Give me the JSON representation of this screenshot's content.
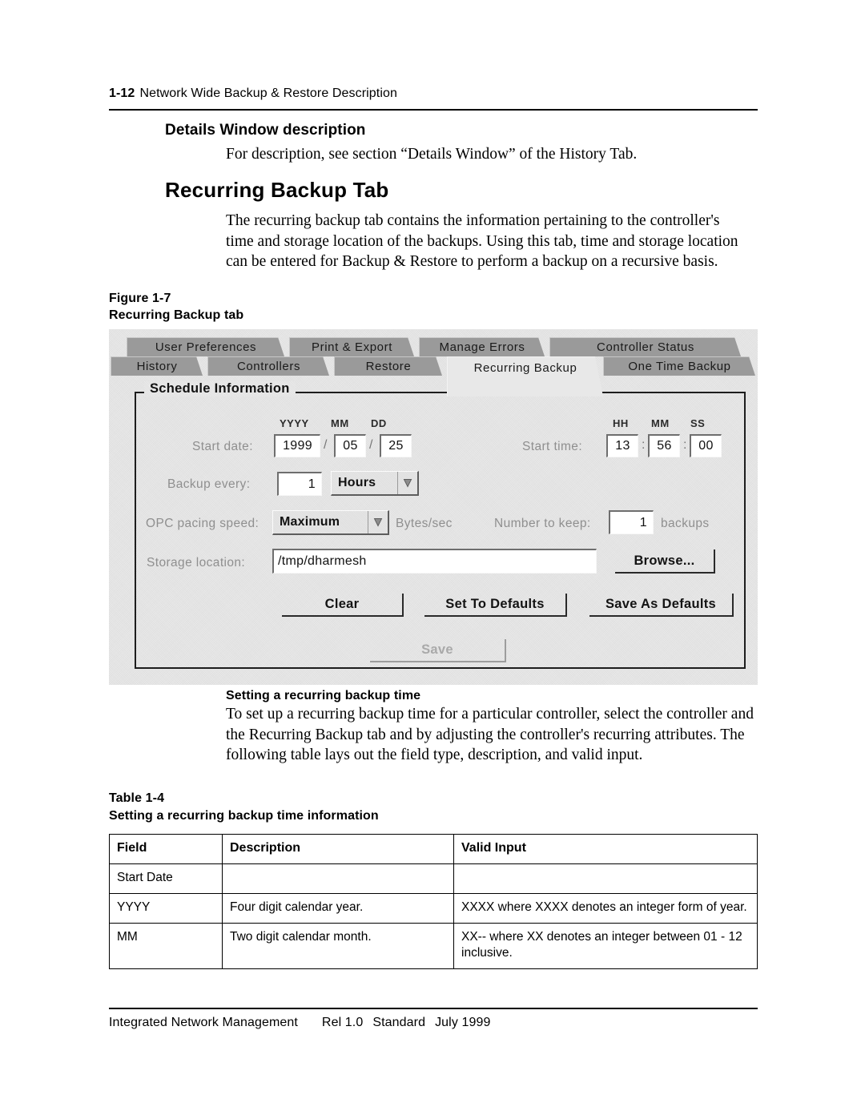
{
  "header": {
    "folio": "1-12",
    "running_title": "Network Wide Backup & Restore Description"
  },
  "sections": {
    "details_heading": "Details Window description",
    "details_body": "For description, see section “Details Window” of the History Tab.",
    "recurring_heading": "Recurring Backup Tab",
    "recurring_body": "The recurring backup tab contains the information pertaining to the controller's time and storage location of the backups.  Using this tab, time and storage location can be entered for Backup & Restore to perform a backup on a recursive basis.",
    "setting_heading": "Setting a recurring backup time",
    "setting_body": "To set up a recurring backup time for a particular controller, select the controller and the Recurring Backup tab and by adjusting the controller's recurring attributes.  The following table lays out the field type, description, and valid input."
  },
  "figure": {
    "number": "Figure 1-7",
    "title": "Recurring Backup tab",
    "tabs_top": [
      {
        "label": "User Preferences",
        "selected": false
      },
      {
        "label": "Print & Export",
        "selected": false
      },
      {
        "label": "Manage Errors",
        "selected": false
      },
      {
        "label": "Controller Status",
        "selected": false
      }
    ],
    "tabs_bottom": [
      {
        "label": "History",
        "selected": false
      },
      {
        "label": "Controllers",
        "selected": false
      },
      {
        "label": "Restore",
        "selected": false
      },
      {
        "label": "Recurring Backup",
        "selected": true
      },
      {
        "label": "One Time Backup",
        "selected": false
      }
    ],
    "group_title": "Schedule Information",
    "start_date": {
      "label": "Start date:",
      "col_yyyy": "YYYY",
      "col_mm": "MM",
      "col_dd": "DD",
      "yyyy": "1999",
      "mm": "05",
      "dd": "25",
      "sep": "/"
    },
    "start_time": {
      "label": "Start time:",
      "col_hh": "HH",
      "col_mm": "MM",
      "col_ss": "SS",
      "hh": "13",
      "mm": "56",
      "ss": "00",
      "sep": ":"
    },
    "backup_every": {
      "label": "Backup every:",
      "value": "1",
      "unit": "Hours"
    },
    "opc_pacing": {
      "label": "OPC pacing speed:",
      "value": "Maximum",
      "unit": "Bytes/sec"
    },
    "number_to_keep": {
      "label": "Number to keep:",
      "value": "1",
      "unit": "backups"
    },
    "storage_location": {
      "label": "Storage location:",
      "value": "/tmp/dharmesh",
      "browse_label": "Browse..."
    },
    "buttons": {
      "clear": "Clear",
      "set_to_defaults": "Set To Defaults",
      "save_as_defaults": "Save As Defaults",
      "save": "Save"
    }
  },
  "table": {
    "number": "Table 1-4",
    "title": "Setting a recurring backup time information",
    "columns": [
      "Field",
      "Description",
      "Valid Input"
    ],
    "rows": [
      {
        "field": "Start Date",
        "description": "",
        "valid_input": ""
      },
      {
        "field": "YYYY",
        "description": "Four digit calendar year.",
        "valid_input": "XXXX where XXXX denotes an integer form of year."
      },
      {
        "field": "MM",
        "description": "Two digit calendar month.",
        "valid_input": "XX-- where XX denotes an integer between 01 - 12 inclusive."
      }
    ]
  },
  "footer": {
    "product": "Integrated Network Management",
    "release": "Rel 1.0",
    "standard": "Standard",
    "date": "July 1999"
  }
}
